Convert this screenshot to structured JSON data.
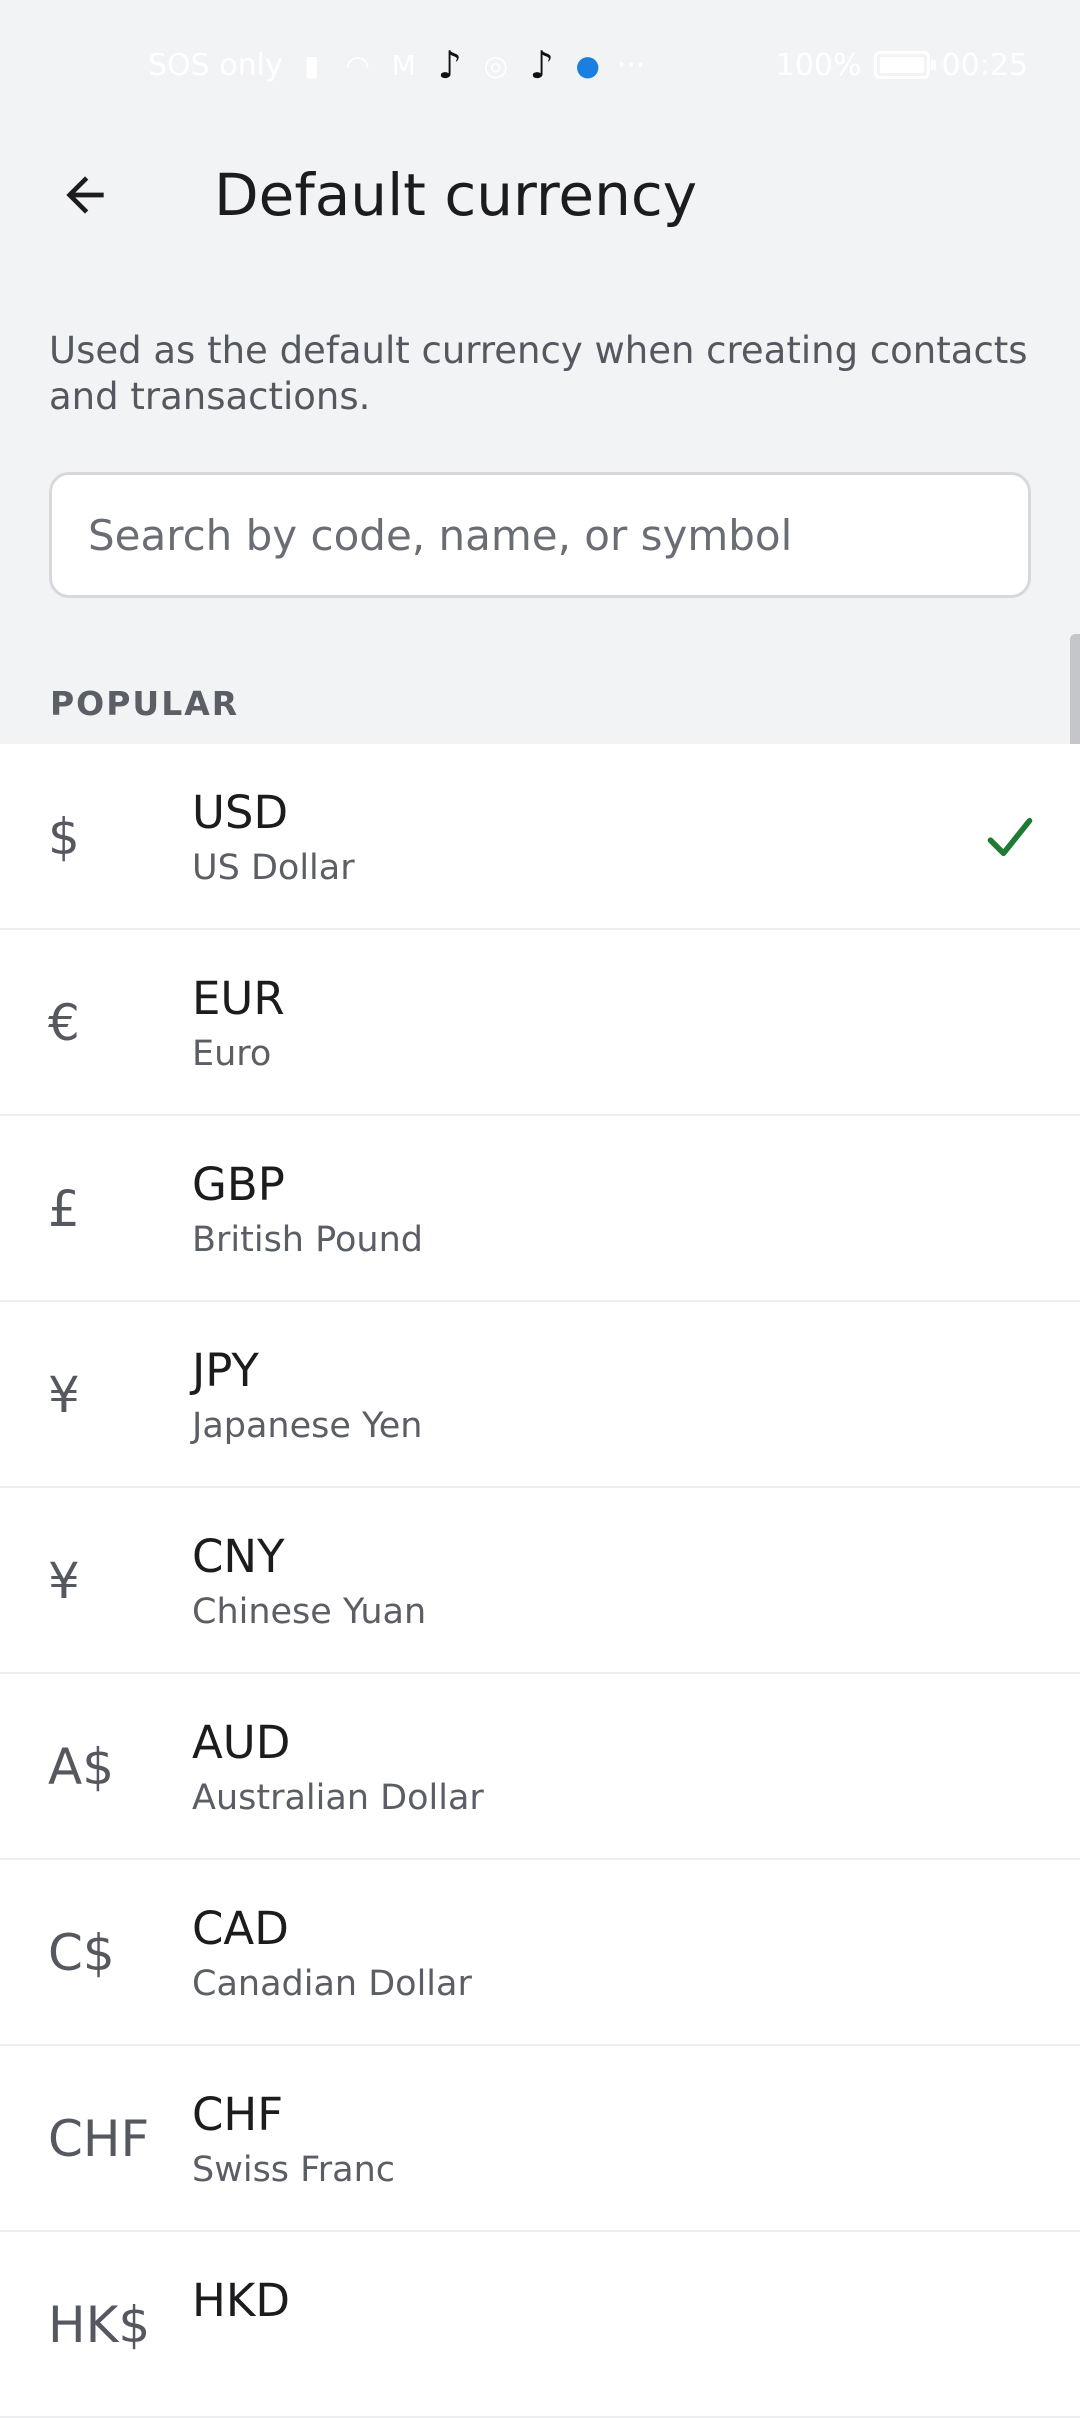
{
  "status_bar": {
    "left_text": "SOS only",
    "battery": "100%",
    "battery_level": 100,
    "time": "00:25",
    "more": "···"
  },
  "header": {
    "title": "Default currency"
  },
  "description": "Used as the default currency when creating contacts and transactions.",
  "search": {
    "placeholder": "Search by code, name, or symbol",
    "value": ""
  },
  "section": {
    "popular_label": "POPULAR"
  },
  "currencies": [
    {
      "symbol": "$",
      "code": "USD",
      "name": "US Dollar",
      "selected": true
    },
    {
      "symbol": "€",
      "code": "EUR",
      "name": "Euro",
      "selected": false
    },
    {
      "symbol": "£",
      "code": "GBP",
      "name": "British Pound",
      "selected": false
    },
    {
      "symbol": "¥",
      "code": "JPY",
      "name": "Japanese Yen",
      "selected": false
    },
    {
      "symbol": "¥",
      "code": "CNY",
      "name": "Chinese Yuan",
      "selected": false
    },
    {
      "symbol": "A$",
      "code": "AUD",
      "name": "Australian Dollar",
      "selected": false
    },
    {
      "symbol": "C$",
      "code": "CAD",
      "name": "Canadian Dollar",
      "selected": false
    },
    {
      "symbol": "CHF",
      "code": "CHF",
      "name": "Swiss Franc",
      "selected": false
    },
    {
      "symbol": "HK$",
      "code": "HKD",
      "name": "",
      "selected": false
    }
  ],
  "colors": {
    "check": "#1e7a34",
    "background": "#f2f3f5"
  }
}
